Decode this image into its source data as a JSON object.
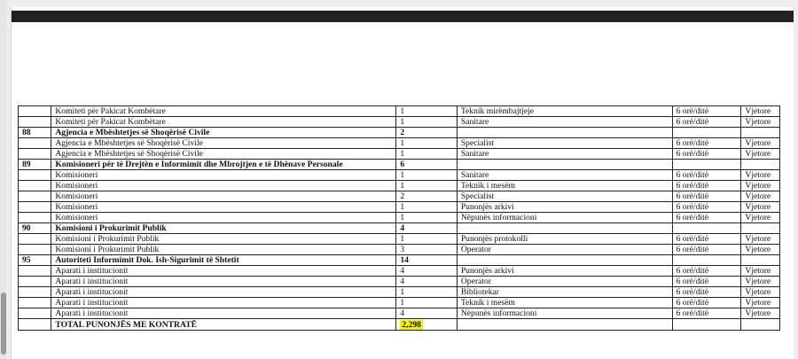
{
  "table": {
    "rows": [
      {
        "type": "item",
        "num": "",
        "name": "Komiteti për Pakicat Kombëtare",
        "count": "1",
        "role": "Teknik mirëmbajtjeje",
        "hours": "6 orë/ditë",
        "period": "Vjetore"
      },
      {
        "type": "item",
        "num": "",
        "name": "Komiteti për Pakicat Kombëtare",
        "count": "1",
        "role": "Sanitare",
        "hours": "6 orë/ditë",
        "period": "Vjetore"
      },
      {
        "type": "head",
        "num": "88",
        "name": "Agjencia e Mbështetjes së Shoqërisë Civile",
        "count": "2",
        "role": "",
        "hours": "",
        "period": ""
      },
      {
        "type": "item",
        "num": "",
        "name": "Agjencia e Mbështetjes së Shoqërisë Civile",
        "count": "1",
        "role": "Specialist",
        "hours": "6 orë/ditë",
        "period": "Vjetore"
      },
      {
        "type": "item",
        "num": "",
        "name": "Agjencia e Mbështetjes së Shoqërisë Civile",
        "count": "1",
        "role": "Sanitare",
        "hours": "6 orë/ditë",
        "period": "Vjetore"
      },
      {
        "type": "head",
        "num": "89",
        "name": "Komisioneri për të Drejtën e Informimit dhe Mbrojtjen e të Dhënave Personale",
        "count": "6",
        "role": "",
        "hours": "",
        "period": ""
      },
      {
        "type": "item",
        "num": "",
        "name": "Komisioneri",
        "count": "1",
        "role": "Sanitare",
        "hours": "6 orë/ditë",
        "period": "Vjetore"
      },
      {
        "type": "item",
        "num": "",
        "name": "Komisioneri",
        "count": "1",
        "role": "Teknik i mesëm",
        "hours": "6 orë/ditë",
        "period": "Vjetore"
      },
      {
        "type": "item",
        "num": "",
        "name": "Komisioneri",
        "count": "2",
        "role": "Specialist",
        "hours": "6 orë/ditë",
        "period": "Vjetore"
      },
      {
        "type": "item",
        "num": "",
        "name": "Komisioneri",
        "count": "1",
        "role": "Punonjës arkivi",
        "hours": "6 orë/ditë",
        "period": "Vjetore"
      },
      {
        "type": "item",
        "num": "",
        "name": "Komisioneri",
        "count": "1",
        "role": "Nëpunës informacioni",
        "hours": "6 orë/ditë",
        "period": "Vjetore"
      },
      {
        "type": "head",
        "num": "90",
        "name": "Komisioni i Prokurimit Publik",
        "count": "4",
        "role": "",
        "hours": "",
        "period": ""
      },
      {
        "type": "item",
        "num": "",
        "name": "Komisioni i Prokurimit Publik",
        "count": "1",
        "role": "Punonjës protokolli",
        "hours": "6 orë/ditë",
        "period": "Vjetore"
      },
      {
        "type": "item",
        "num": "",
        "name": "Komisioni i Prokurimit Publik",
        "count": "3",
        "role": "Operator",
        "hours": "6 orë/ditë",
        "period": "Vjetore"
      },
      {
        "type": "head",
        "num": "95",
        "name": "Autoriteti Informimit Dok. Ish-Sigurimit të Shtetit",
        "count": "14",
        "role": "",
        "hours": "",
        "period": ""
      },
      {
        "type": "item",
        "num": "",
        "name": "Aparati i institucionit",
        "count": "4",
        "role": "Punonjës arkivi",
        "hours": "6 orë/ditë",
        "period": "Vjetore"
      },
      {
        "type": "item",
        "num": "",
        "name": "Aparati i institucionit",
        "count": "4",
        "role": "Operator",
        "hours": "6 orë/ditë",
        "period": "Vjetore"
      },
      {
        "type": "item",
        "num": "",
        "name": "Aparati i institucionit",
        "count": "1",
        "role": "Bibliotekar",
        "hours": "6 orë/ditë",
        "period": "Vjetore"
      },
      {
        "type": "item",
        "num": "",
        "name": "Aparati i institucionit",
        "count": "1",
        "role": "Teknik i mesëm",
        "hours": "6 orë/ditë",
        "period": "Vjetore"
      },
      {
        "type": "item",
        "num": "",
        "name": "Aparati i institucionit",
        "count": "4",
        "role": "Nëpunës informacioni",
        "hours": "6 orë/ditë",
        "period": "Vjetore"
      }
    ],
    "total": {
      "label": "TOTAL PUNONJËS ME KONTRATË",
      "count": "2,298"
    }
  },
  "colors": {
    "highlight": "#f5f000",
    "top_bar": "#222222"
  }
}
